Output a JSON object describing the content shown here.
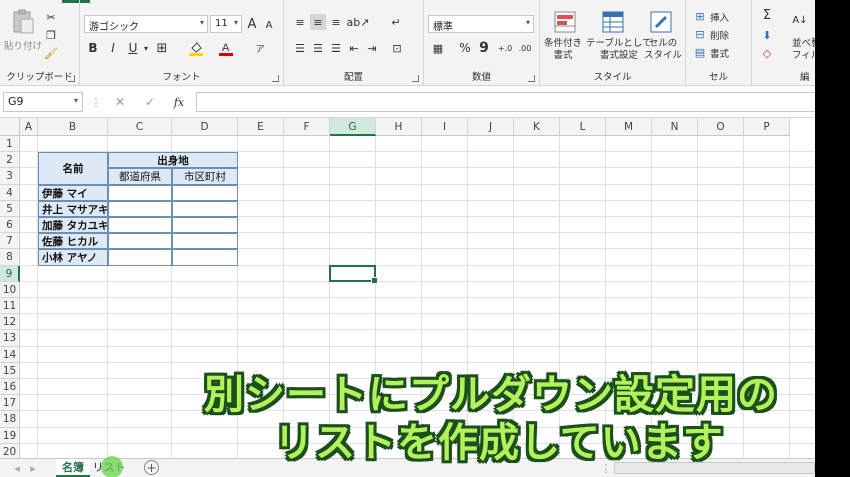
{
  "ribbon": {
    "clipboard": {
      "paste": "貼り付け",
      "label": "クリップボード"
    },
    "font": {
      "name": "游ゴシック",
      "size": "11",
      "grow": "A",
      "shrink": "A",
      "bold": "B",
      "italic": "I",
      "underline": "U",
      "label": "フォント"
    },
    "alignment": {
      "label": "配置"
    },
    "number": {
      "format": "標準",
      "percent": "%",
      "comma": "9",
      "label": "数値"
    },
    "styles": {
      "conditional": "条件付き\n書式",
      "table": "テーブルとして\n書式設定",
      "cell": "セルの\nスタイル",
      "label": "スタイル"
    },
    "cells": {
      "insert": "挿入",
      "delete": "削除",
      "format": "書式",
      "label": "セル"
    },
    "editing": {
      "sort": "並べ替\nフィル",
      "label": "編"
    }
  },
  "formula_bar": {
    "name_box": "G9",
    "cancel": "✕",
    "enter": "✓",
    "fx": "fx",
    "value": ""
  },
  "columns": [
    "A",
    "B",
    "C",
    "D",
    "E",
    "F",
    "G",
    "H",
    "I",
    "J",
    "K",
    "L",
    "M",
    "N",
    "O",
    "P"
  ],
  "active_column": "G",
  "rows": [
    "1",
    "2",
    "3",
    "4",
    "5",
    "6",
    "7",
    "8",
    "9",
    "10",
    "11",
    "12",
    "13",
    "14",
    "15",
    "16",
    "17",
    "18",
    "19",
    "20"
  ],
  "active_row": "9",
  "table": {
    "name_header": "名前",
    "origin_header": "出身地",
    "prefecture_header": "都道府県",
    "city_header": "市区町村",
    "names": [
      "伊藤 マイ",
      "井上 マサアキ",
      "加藤 タカユキ",
      "佐藤 ヒカル",
      "小林 アヤノ"
    ]
  },
  "sheets": {
    "tab1": "名簿",
    "tab2": "リスト",
    "add": "+"
  },
  "caption": {
    "line1": "別シートにプルダウン設定用の",
    "line2": "リストを作成しています"
  },
  "colors": {
    "accent": "#217346",
    "table_fill": "#dde9f6",
    "caption_fill": "#b4f25d",
    "caption_outline": "#1b4f1b"
  }
}
